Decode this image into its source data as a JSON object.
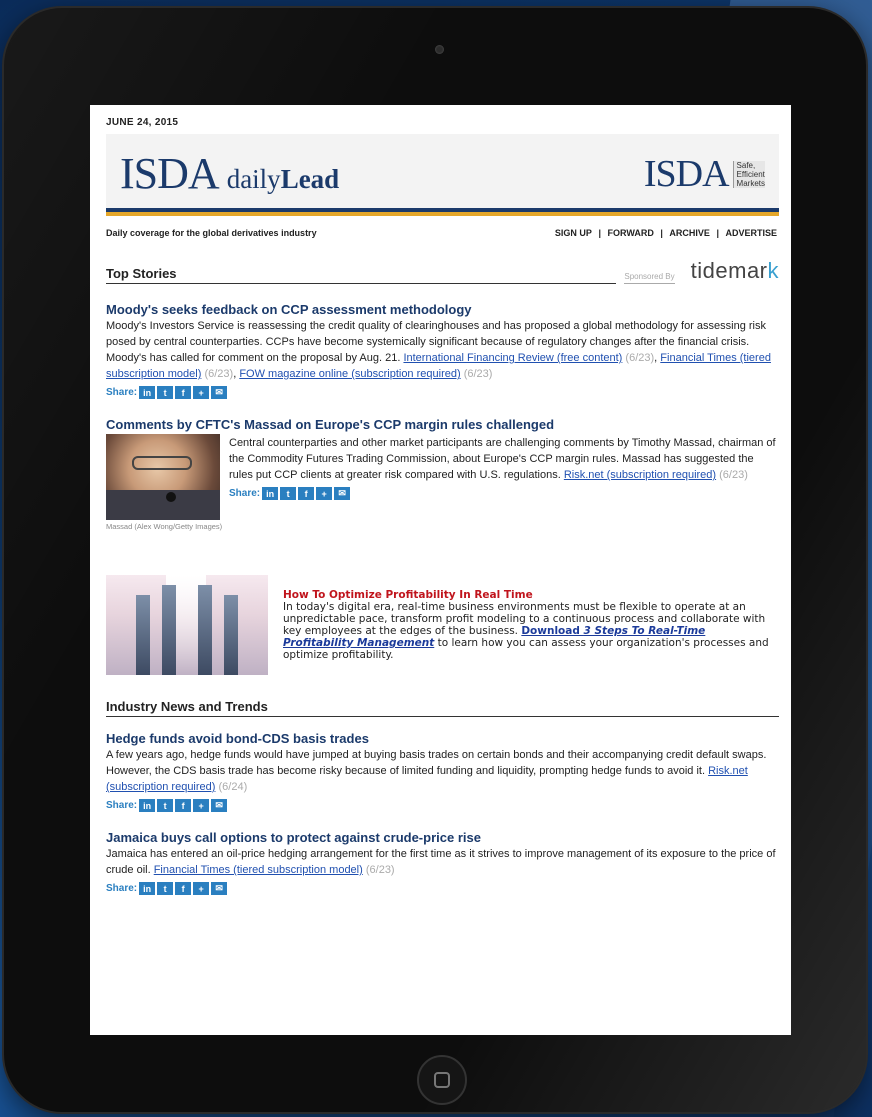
{
  "newsletter": {
    "date": "JUNE 24, 2015",
    "brand": {
      "isda": "ISDA",
      "daily": "daily",
      "lead": "Lead",
      "tagline": [
        "Safe,",
        "Efficient",
        "Markets"
      ]
    },
    "tagline_bar": "Daily coverage for the global derivatives industry",
    "nav": {
      "signup": "SIGN UP",
      "forward": "FORWARD",
      "archive": "ARCHIVE",
      "advertise": "ADVERTISE",
      "sep": "|"
    },
    "share_label": "Share:",
    "share_icons": {
      "linkedin": "in",
      "twitter": "t",
      "facebook": "f",
      "plus": "+",
      "email": "✉"
    }
  },
  "top_stories": {
    "title": "Top Stories",
    "sponsored": "Sponsored By",
    "sponsor_logo": {
      "text": "tidemar",
      "k": "k"
    },
    "article1": {
      "headline": "Moody's seeks feedback on CCP assessment methodology",
      "body": "Moody's Investors Service is reassessing the credit quality of clearinghouses and has proposed a global methodology for assessing risk posed by central counterparties. CCPs have become systemically significant because of regulatory changes after the financial crisis. Moody's has called for comment on the proposal by Aug. 21.",
      "link1": "International Financing Review (free content)",
      "date1": "(6/23)",
      "link2": "Financial Times (tiered subscription model)",
      "date2": "(6/23)",
      "link3": "FOW magazine online (subscription required)",
      "date3": "(6/23)"
    },
    "article2": {
      "headline": "Comments by CFTC's Massad on Europe's CCP margin rules challenged",
      "body": "Central counterparties and other market participants are challenging comments by Timothy Massad, chairman of the Commodity Futures Trading Commission, about Europe's CCP margin rules. Massad has suggested the rules put CCP clients at greater risk compared with U.S. regulations.",
      "link": "Risk.net (subscription required)",
      "date": "(6/23)",
      "caption": "Massad (Alex Wong/Getty Images)"
    }
  },
  "ad": {
    "title": "How To Optimize Profitability In Real Time",
    "body": "In today's digital era, real-time business environments must be flexible to operate at an unpredictable pace, transform profit modeling to a continuous process and collaborate with key employees at the edges of the business.",
    "link_prefix": "Download ",
    "link_italic": "3 Steps To Real-Time Profitability Management",
    "tail": " to learn how you can assess your organization's processes and optimize profitability."
  },
  "industry": {
    "title": "Industry News and Trends",
    "article1": {
      "headline": "Hedge funds avoid bond-CDS basis trades",
      "body": "A few years ago, hedge funds would have jumped at buying basis trades on certain bonds and their accompanying credit default swaps. However, the CDS basis trade has become risky because of limited funding and liquidity, prompting hedge funds to avoid it.",
      "link": "Risk.net (subscription required)",
      "date": "(6/24)"
    },
    "article2": {
      "headline": "Jamaica buys call options to protect against crude-price rise",
      "body": "Jamaica has entered an oil-price hedging arrangement for the first time as it strives to improve management of its exposure to the price of crude oil.",
      "link": "Financial Times (tiered subscription model)",
      "date": "(6/23)"
    }
  }
}
